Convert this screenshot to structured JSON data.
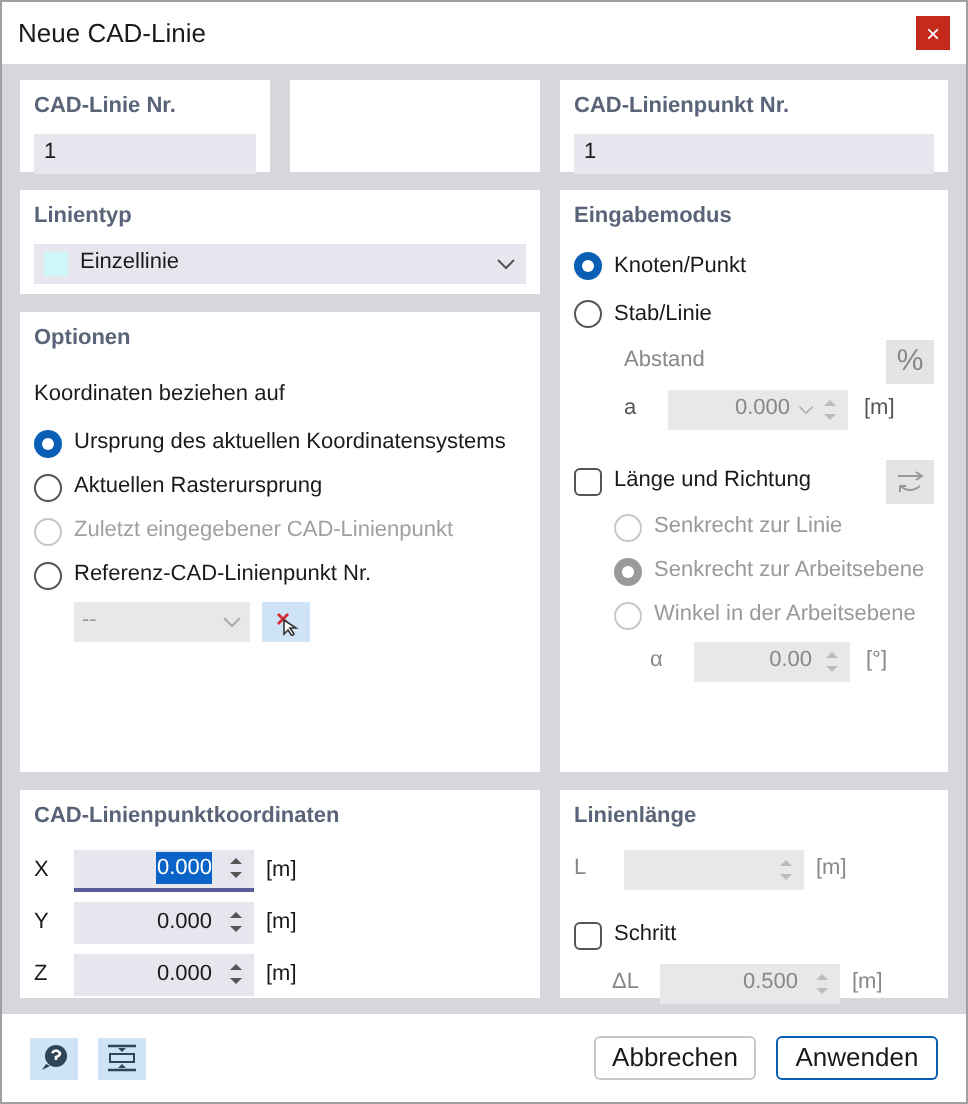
{
  "window": {
    "title": "Neue CAD-Linie",
    "close": "×"
  },
  "line_no": {
    "label": "CAD-Linie Nr.",
    "value": "1"
  },
  "point_no": {
    "label": "CAD-Linienpunkt Nr.",
    "value": "1"
  },
  "line_type": {
    "label": "Linientyp",
    "value": "Einzellinie"
  },
  "options": {
    "title": "Optionen",
    "subtitle": "Koordinaten beziehen auf",
    "choices": [
      {
        "label": "Ursprung des aktuellen Koordinatensystems",
        "selected": true,
        "disabled": false
      },
      {
        "label": "Aktuellen Rasterursprung",
        "selected": false,
        "disabled": false
      },
      {
        "label": "Zuletzt eingegebener CAD-Linienpunkt",
        "selected": false,
        "disabled": true
      },
      {
        "label": "Referenz-CAD-Linienpunkt Nr.",
        "selected": false,
        "disabled": false
      }
    ],
    "reference": {
      "value": "--",
      "disabled": true
    }
  },
  "input_mode": {
    "title": "Eingabemodus",
    "choices": [
      {
        "label": "Knoten/Punkt",
        "selected": true
      },
      {
        "label": "Stab/Linie",
        "selected": false
      }
    ],
    "distance": {
      "label": "Abstand",
      "percent": "%",
      "var": "a",
      "value": "0.000",
      "unit": "[m]",
      "disabled": true
    },
    "length_direction": {
      "label": "Länge und Richtung",
      "checked": false,
      "choices": [
        {
          "label": "Senkrecht zur Linie",
          "selected": false
        },
        {
          "label": "Senkrecht zur Arbeitsebene",
          "selected": true
        },
        {
          "label": "Winkel in der Arbeitsebene",
          "selected": false
        }
      ],
      "angle": {
        "var": "α",
        "value": "0.00",
        "unit": "[°]"
      }
    }
  },
  "coordinates": {
    "title": "CAD-Linienpunktkoordinaten",
    "rows": [
      {
        "axis": "X",
        "value": "0.000",
        "unit": "[m]",
        "focused": true
      },
      {
        "axis": "Y",
        "value": "0.000",
        "unit": "[m]",
        "focused": false
      },
      {
        "axis": "Z",
        "value": "0.000",
        "unit": "[m]",
        "focused": false
      }
    ]
  },
  "line_length": {
    "title": "Linienlänge",
    "length": {
      "var": "L",
      "unit": "[m]"
    },
    "step": {
      "label": "Schritt",
      "checked": false,
      "var": "ΔL",
      "value": "0.500",
      "unit": "[m]"
    }
  },
  "buttons": [
    {
      "label": "Abbrechen",
      "primary": false
    },
    {
      "label": "Anwenden",
      "primary": true
    }
  ]
}
